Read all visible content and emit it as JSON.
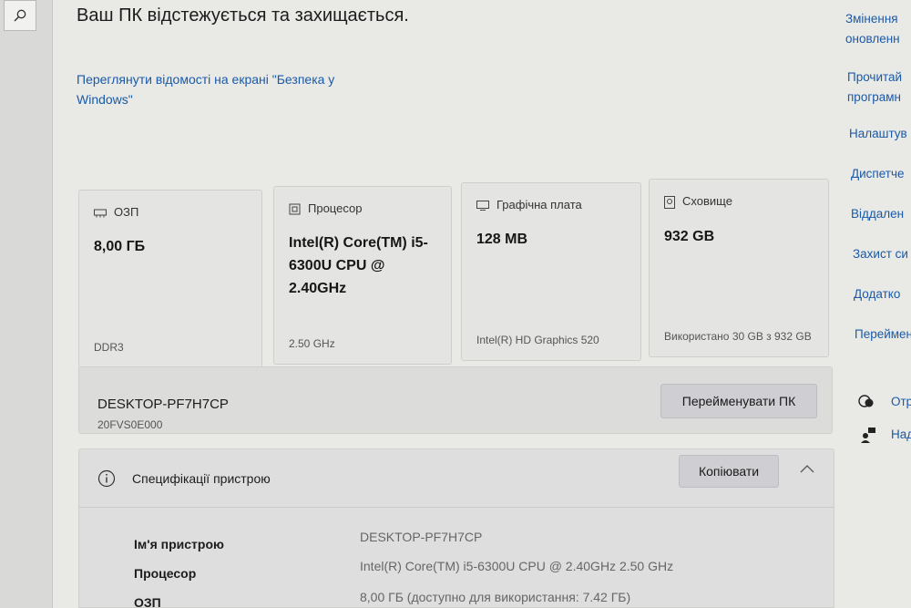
{
  "search": {
    "icon": "search-icon"
  },
  "headline": "Ваш ПК відстежується та захищається.",
  "security_link": "Переглянути відомості на екрані \"Безпека у Windows\"",
  "cards": [
    {
      "label": "ОЗП",
      "icon": "memory-icon",
      "value": "8,00 ГБ",
      "footer": "DDR3"
    },
    {
      "label": "Процесор",
      "icon": "processor-icon",
      "value": "Intel(R) Core(TM) i5-6300U CPU @ 2.40GHz",
      "footer": "2.50 GHz"
    },
    {
      "label": "Графічна плата",
      "icon": "display-adapter-icon",
      "value": "128 MB",
      "footer": "Intel(R) HD Graphics 520"
    },
    {
      "label": "Сховище",
      "icon": "storage-icon",
      "value": "932 GB",
      "footer": "Використано 30 GB з 932 GB"
    }
  ],
  "device": {
    "name": "DESKTOP-PF7H7CP",
    "model": "20FVS0E000",
    "rename_label": "Перейменувати ПК"
  },
  "specs": {
    "title": "Специфікації пристрою",
    "copy_label": "Копіювати",
    "rows": [
      {
        "key": "Ім'я пристрою",
        "value": "DESKTOP-PF7H7CP"
      },
      {
        "key": "Процесор",
        "value": "Intel(R) Core(TM) i5-6300U CPU @ 2.40GHz   2.50 GHz"
      },
      {
        "key": "ОЗП",
        "value": "8,00 ГБ (доступно для використання: 7.42 ГБ)"
      }
    ]
  },
  "right_links": [
    {
      "line1": "Змінення ",
      "line2": "оновленн"
    },
    {
      "line1": "Прочитай",
      "line2": "програмн"
    },
    {
      "line1": "Налаштув"
    },
    {
      "line1": "Диспетче"
    },
    {
      "line1": "Віддален"
    },
    {
      "line1": "Захист си"
    },
    {
      "line1": "Додатко"
    },
    {
      "line1": "Переймен"
    }
  ],
  "help_links": [
    {
      "label": "Отр",
      "icon": "get-help-icon"
    },
    {
      "label": "Над",
      "icon": "feedback-icon"
    }
  ],
  "colors": {
    "link": "#1a5aa8",
    "background": "#e9e9e6",
    "card": "#e4e4e2"
  }
}
